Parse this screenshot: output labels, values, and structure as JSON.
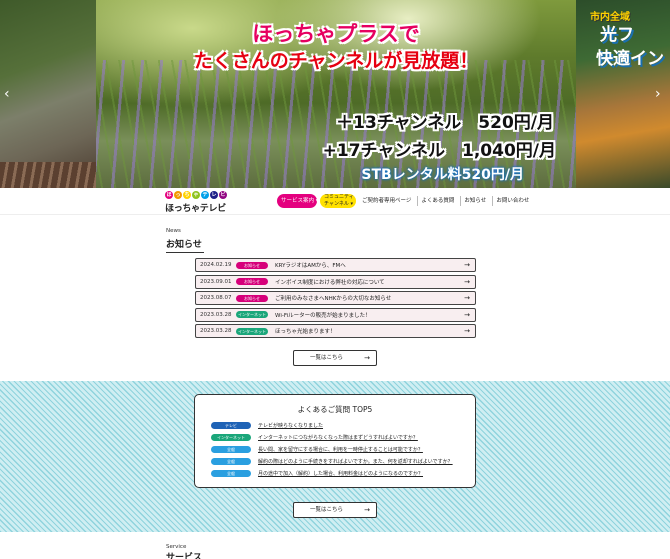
{
  "hero": {
    "headline_1": "ほっちゃプラスで",
    "headline_2": "たくさんのチャンネルが見放題！",
    "price_1": "＋13チャンネル　520円/月",
    "price_2": "+17チャンネル　1,040円/月",
    "stb": "STBレンタル料520円/月",
    "side_tag": "市内全域",
    "side_line_1": "光フ",
    "side_line_2": "快適イン",
    "prev_icon": "chevron-left-icon",
    "next_icon": "chevron-right-icon"
  },
  "header": {
    "logo_name": "ほっちゃテレビ",
    "logo_dots": [
      "ほ",
      "っ",
      "ち",
      "ゃ",
      "テ",
      "レ",
      "ビ"
    ],
    "nav": {
      "service": "サービス案内 ▾",
      "community_1": "コミュニティ",
      "community_2": "チャンネル ▾",
      "links": [
        "ご契約者専用ページ",
        "よくある質問",
        "お知らせ",
        "お問い合わせ"
      ]
    }
  },
  "news": {
    "eyebrow": "News",
    "title": "お知らせ",
    "items": [
      {
        "date": "2024.02.19",
        "badge": "お知らせ",
        "text": "KRYラジオはAMから、FMへ"
      },
      {
        "date": "2023.09.01",
        "badge": "お知らせ",
        "text": "インボイス制度における弊社の対応について"
      },
      {
        "date": "2023.08.07",
        "badge": "お知らせ",
        "text": "ご利用のみなさまへNHKからの大切なお知らせ"
      },
      {
        "date": "2023.03.28",
        "badge": "インターネット",
        "text": "Wi-Fiルーターの販売が始まりました！"
      },
      {
        "date": "2023.03.28",
        "badge": "インターネット",
        "text": "ほっちゃ光始まります！"
      }
    ],
    "more": "一覧はこちら"
  },
  "faq": {
    "title": "よくあるご質問 TOP5",
    "items": [
      {
        "badge": "テレビ",
        "text": "テレビが映らなくなりました"
      },
      {
        "badge": "インターネット",
        "text": "インターネットにつながらなくなった際はまずどうすればよいですか？"
      },
      {
        "badge": "全般",
        "text": "長い間、家を留守にする場合に、利用を一時停止することは可能ですか？"
      },
      {
        "badge": "全般",
        "text": "解約の際はどのように手続きをすればよいですか。また、何を返却すればよいですか？"
      },
      {
        "badge": "全般",
        "text": "月の途中で加入（解約）した場合、利用料金はどのようになるのですか？"
      }
    ],
    "more": "一覧はこちら"
  },
  "service": {
    "eyebrow": "Service",
    "title": "サービス"
  },
  "colors": {
    "brand_pink": "#e4007f",
    "brand_yellow": "#ffe100",
    "badge_notice": "#d6007a",
    "badge_internet": "#1aa67a",
    "badge_tv": "#1f63b6",
    "badge_general": "#2a9fe0",
    "faq_stripes": "#8fd3dd"
  }
}
